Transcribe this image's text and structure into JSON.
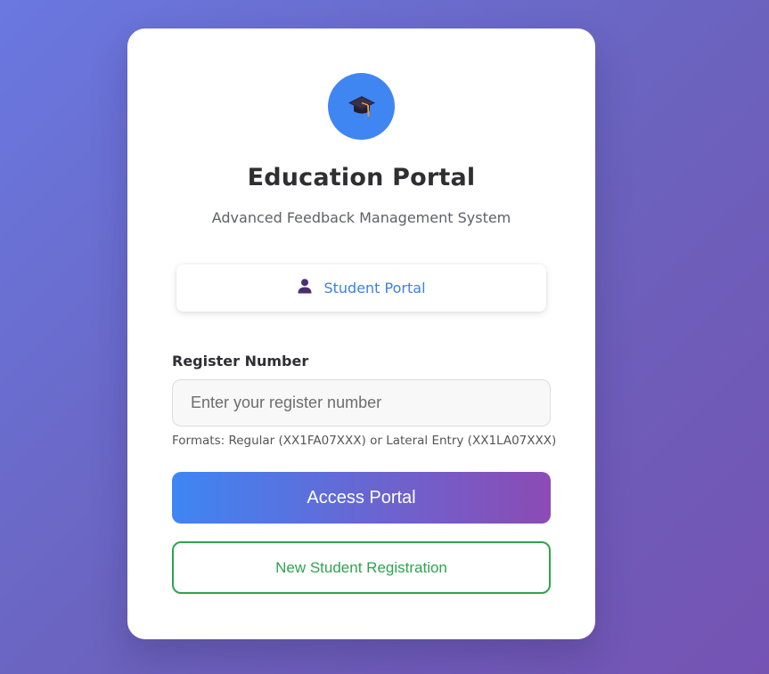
{
  "app": {
    "logo_icon": "graduation-cap-icon",
    "title": "Education Portal",
    "subtitle": "Advanced Feedback Management System"
  },
  "portal_tab": {
    "icon": "user-icon",
    "label": "Student Portal"
  },
  "form": {
    "register_label": "Register Number",
    "register_placeholder": "Enter your register number",
    "register_value": "",
    "hint": "Formats: Regular (XX1FA07XXX) or Lateral Entry (XX1LA07XXX)",
    "submit_label": "Access Portal",
    "register_new_label": "New Student Registration"
  },
  "colors": {
    "accent_blue": "#3f86f3",
    "accent_purple": "#8c4bb4",
    "success_green": "#2ea44f"
  }
}
